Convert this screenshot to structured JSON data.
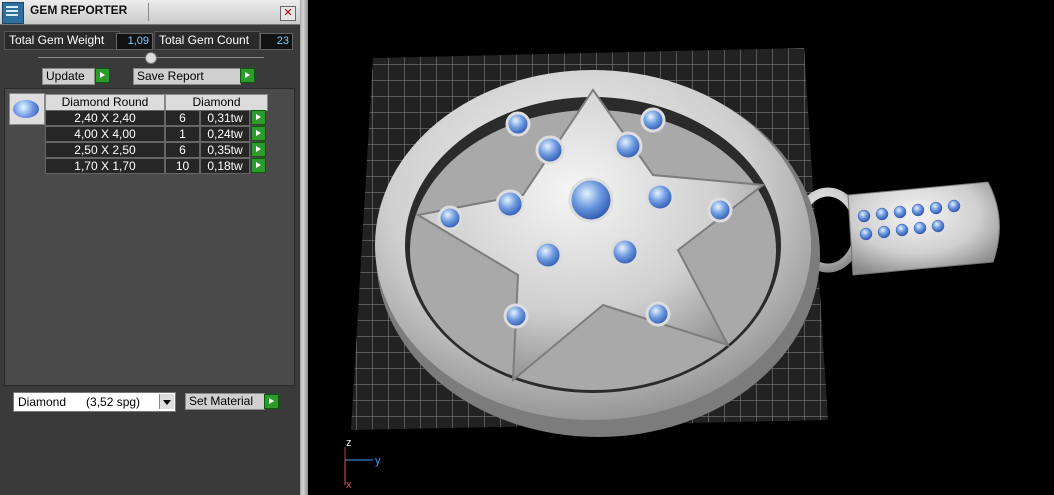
{
  "panel": {
    "title": "GEM REPORTER",
    "close_icon": "close-icon",
    "total_gem_weight_label": "Total Gem Weight",
    "total_gem_weight_value": "1,09",
    "total_gem_count_label": "Total Gem Count",
    "total_gem_count_value": "23",
    "update_label": "Update",
    "save_report_label": "Save Report",
    "table_headers": [
      "Diamond Round",
      "Diamond"
    ],
    "gems": [
      {
        "size": "2,40 X 2,40",
        "count": "6",
        "weight": "0,31tw"
      },
      {
        "size": "4,00 X 4,00",
        "count": "1",
        "weight": "0,24tw"
      },
      {
        "size": "2,50 X 2,50",
        "count": "6",
        "weight": "0,35tw"
      },
      {
        "size": "1,70 X 1,70",
        "count": "10",
        "weight": "0,18tw"
      }
    ],
    "material_select": "Diamond      (3,52 spg)",
    "set_material_label": "Set Material"
  },
  "viewport": {
    "axis_labels": {
      "z": "z",
      "y": "y",
      "x": "x"
    },
    "colors": {
      "gem": "#6f9be0",
      "metal": "#d9d9d9",
      "grid": "#bfbfbf",
      "accent": "#2e9a2e"
    }
  }
}
